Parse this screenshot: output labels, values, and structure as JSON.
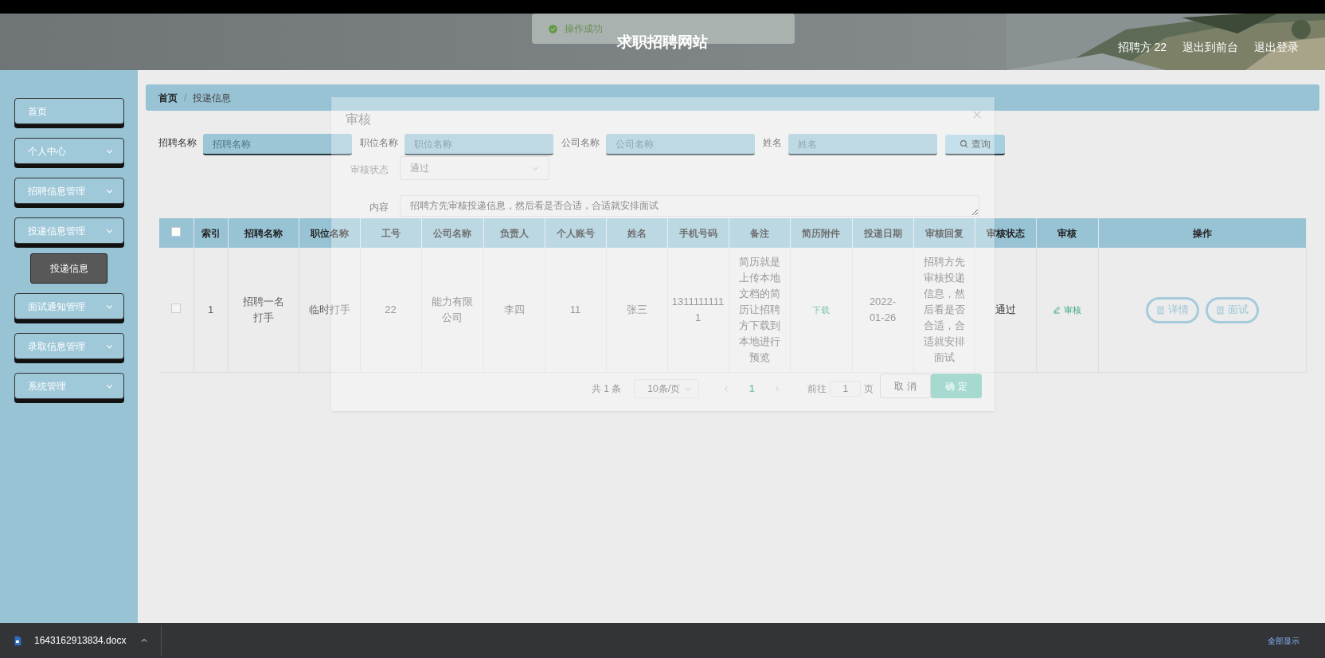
{
  "toast": {
    "text": "操作成功"
  },
  "header": {
    "title": "求职招聘网站",
    "links": [
      "招聘方 22",
      "退出到前台",
      "退出登录"
    ]
  },
  "sidebar": {
    "items": [
      {
        "label": "首页",
        "kind": "link"
      },
      {
        "label": "个人中心",
        "kind": "submenu"
      },
      {
        "label": "招聘信息管理",
        "kind": "submenu"
      },
      {
        "label": "投递信息管理",
        "kind": "submenu",
        "children": [
          {
            "label": "投递信息",
            "selected": true
          }
        ]
      },
      {
        "label": "面试通知管理",
        "kind": "submenu"
      },
      {
        "label": "录取信息管理",
        "kind": "submenu"
      },
      {
        "label": "系统管理",
        "kind": "submenu"
      }
    ]
  },
  "breadcrumb": {
    "separator": "/",
    "items": [
      "首页",
      "投递信息"
    ]
  },
  "search": {
    "fields": [
      {
        "label": "招聘名称",
        "placeholder": "招聘名称"
      },
      {
        "label": "职位名称",
        "placeholder": "职位名称"
      },
      {
        "label": "公司名称",
        "placeholder": "公司名称"
      },
      {
        "label": "姓名",
        "placeholder": "姓名"
      }
    ],
    "button": "查询"
  },
  "table": {
    "all_checked": false,
    "columns": [
      "索引",
      "招聘名称",
      "职位名称",
      "工号",
      "公司名称",
      "负责人",
      "个人账号",
      "姓名",
      "手机号码",
      "备注",
      "简历附件",
      "投递日期",
      "审核回复",
      "审核状态",
      "审核",
      "操作"
    ],
    "rows": [
      {
        "checked": false,
        "cells": [
          {
            "kind": "text",
            "text": "1"
          },
          {
            "kind": "text",
            "text": "招聘一名打手"
          },
          {
            "kind": "text",
            "text": "临时打手"
          },
          {
            "kind": "text",
            "text": "22"
          },
          {
            "kind": "text",
            "text": "能力有限公司"
          },
          {
            "kind": "text",
            "text": "李四"
          },
          {
            "kind": "text",
            "text": "11"
          },
          {
            "kind": "text",
            "text": "张三"
          },
          {
            "kind": "number",
            "text": "13111111111"
          },
          {
            "kind": "text",
            "text": "简历就是上传本地文档的简历让招聘方下载到本地进行预览"
          },
          {
            "kind": "link",
            "text": "下载"
          },
          {
            "kind": "text",
            "text": "2022-01-26"
          },
          {
            "kind": "text",
            "text": "招聘方先审核投递信息，然后看是否合适，合适就安排面试"
          },
          {
            "kind": "status",
            "text": "通过"
          },
          {
            "kind": "edit",
            "text": "审核"
          },
          {
            "kind": "actions",
            "buttons": [
              "详情",
              "面试"
            ]
          }
        ]
      }
    ]
  },
  "pagination": {
    "total": "共 1 条",
    "page_size": "10条/页",
    "pages": [
      {
        "label": "1",
        "selected": true
      }
    ],
    "goto_label": "前往",
    "goto_value": "1",
    "goto_suffix": "页"
  },
  "dialog": {
    "title": "审核",
    "fields": [
      {
        "kind": "select",
        "label": "审核状态",
        "value": "通过"
      },
      {
        "kind": "textarea",
        "label": "内容",
        "value": "招聘方先审核投递信息，然后看是否合适，合适就安排面试"
      }
    ],
    "buttons": [
      {
        "label": "取 消",
        "kind": "default"
      },
      {
        "label": "确 定",
        "kind": "primary"
      }
    ]
  },
  "download_bar": {
    "file": "1643162913834.docx",
    "show_all": "全部显示"
  }
}
